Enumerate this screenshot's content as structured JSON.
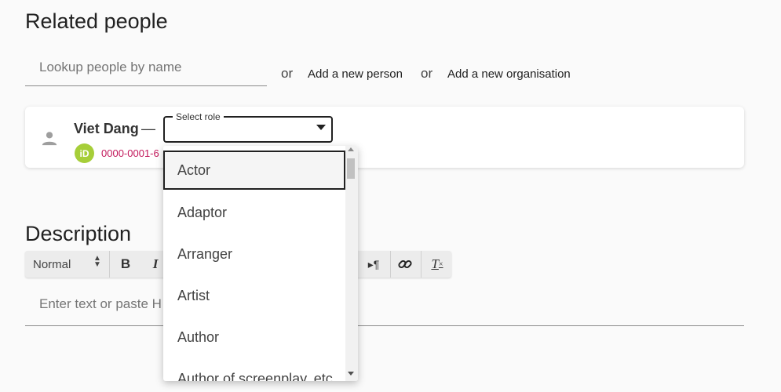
{
  "related_people": {
    "title": "Related people",
    "lookup_placeholder": "Lookup people by name",
    "or_1": "or",
    "add_person": "Add a new person",
    "or_2": "or",
    "add_organisation": "Add a new organisation"
  },
  "person": {
    "name": "Viet Dang",
    "dash": "—",
    "orcid_badge": "iD",
    "orcid_id": "0000-0001-6",
    "icon": "person-icon"
  },
  "role_select": {
    "label": "Select role",
    "value": ""
  },
  "role_options": [
    "Actor",
    "Adaptor",
    "Arranger",
    "Artist",
    "Author",
    "Author of screenplay, etc"
  ],
  "description": {
    "title": "Description",
    "format_value": "Normal",
    "editor_placeholder": "Enter text or paste H",
    "toolbar_icons": [
      "bold-icon",
      "italic-icon",
      "rtl-direction-icon",
      "link-icon",
      "clear-format-icon"
    ]
  },
  "colors": {
    "orcid_green": "#a6ce39",
    "orcid_id_text": "#c2185b"
  }
}
